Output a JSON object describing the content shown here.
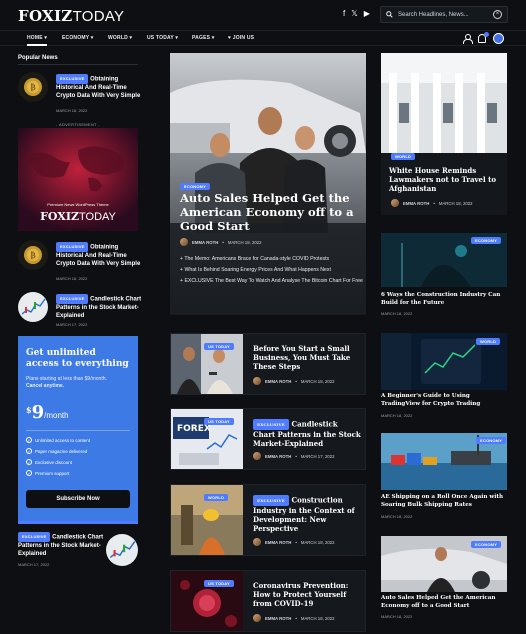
{
  "header": {
    "logo_bold": "FOXIZ",
    "logo_light": "TODAY",
    "social": [
      "f",
      "𝕏",
      "▶"
    ],
    "search_placeholder": "Search Headlines, News..."
  },
  "nav": {
    "items": [
      "HOME ▾",
      "ECONOMY ▾",
      "WORLD ▾",
      "US TODAY ▾",
      "PAGES ▾",
      "♥ JOIN US"
    ],
    "active_index": 0
  },
  "left": {
    "popular_title": "Popular News",
    "items": [
      {
        "tag": "EXCLUSIVE",
        "title": "Obtaining Historical And Real-Time Crypto Data With Very Simple",
        "date": "MARCH 18, 2022"
      },
      {
        "tag": "EXCLUSIVE",
        "title": "Obtaining Historical And Real-Time Crypto Data With Very Simple",
        "date": "MARCH 18, 2022"
      },
      {
        "tag": "EXCLUSIVE",
        "title": "Candlestick Chart Patterns in the Stock Market-Explained",
        "date": "MARCH 17, 2022"
      }
    ],
    "ad_label": "- ADVERTISEMENT -",
    "ad_line": "Premium News WordPress Theme",
    "ad_logo_bold": "FOXIZ",
    "ad_logo_light": "TODAY",
    "subscribe": {
      "heading": "Get unlimited access to everything",
      "small1": "Plans starting at less than $9/month.",
      "small2": "Cancel anytime.",
      "currency": "$",
      "amount": "9",
      "per": "/month",
      "features": [
        "Unlimited access to content",
        "Paper magazine delivered",
        "Exclusive discount",
        "Premium support"
      ],
      "button": "Subscribe Now"
    },
    "bottom_item": {
      "tag": "EXCLUSIVE",
      "title": "Candlestick Chart Patterns in the Stock Market-Explained",
      "date": "MARCH 17, 2022"
    }
  },
  "center": {
    "hero": {
      "tag": "ECONOMY",
      "title": "Auto Sales Helped Get the American Economy off to a Good Start",
      "author": "EMMA ROTH",
      "date": "MARCH 18, 2022",
      "links": [
        "+ The Memo: Americans Brace for Canada-style COVID Protests",
        "+ What Is Behind Soaring Energy Prices And What Happens Next",
        "+ EXCLUSIVE The Best Way To Watch And Analyse The Bitcoin Chart For Free"
      ]
    },
    "cards": [
      {
        "tag": "US TODAY",
        "badge": "",
        "title": "Before You Start a Small Business, You Must Take These Steps",
        "author": "EMMA ROTH",
        "date": "MARCH 18, 2022"
      },
      {
        "tag": "US TODAY",
        "badge": "EXCLUSIVE",
        "title": "Candlestick Chart Patterns in the Stock Market-Explained",
        "author": "EMMA ROTH",
        "date": "MARCH 17, 2022"
      },
      {
        "tag": "WORLD",
        "badge": "EXCLUSIVE",
        "title": "Construction Industry in the Context of Development: New Perspective",
        "author": "EMMA ROTH",
        "date": "MARCH 18, 2022"
      },
      {
        "tag": "US TODAY",
        "badge": "",
        "title": "Coronavirus Prevention: How to Protect Yourself from COVID-19",
        "author": "EMMA ROTH",
        "date": "MARCH 18, 2022"
      }
    ]
  },
  "right": {
    "feature": {
      "tag": "WORLD",
      "title": "White House Reminds Lawmakers not to Travel to Afghanistan",
      "author": "EMMA ROTH",
      "date": "MARCH 18, 2022"
    },
    "items": [
      {
        "tag": "ECONOMY",
        "title": "6 Ways the Construction Industry Can Build for the Future",
        "date": "MARCH 18, 2022"
      },
      {
        "tag": "WORLD",
        "title": "A Beginner's Guide to Using TradingView for Crypto Trading",
        "date": "MARCH 18, 2022"
      },
      {
        "tag": "ECONOMY",
        "title": "AE Shipping on a Roll Once Again with Soaring Bulk Shipping Rates",
        "date": "MARCH 18, 2022"
      },
      {
        "tag": "ECONOMY",
        "title": "Auto Sales Helped Get the American Economy off to a Good Start",
        "date": "MARCH 18, 2022"
      }
    ]
  },
  "colors": {
    "accent": "#4f7cff",
    "background": "#0d0f12",
    "subscribe_bg": "#3e7ae6"
  }
}
